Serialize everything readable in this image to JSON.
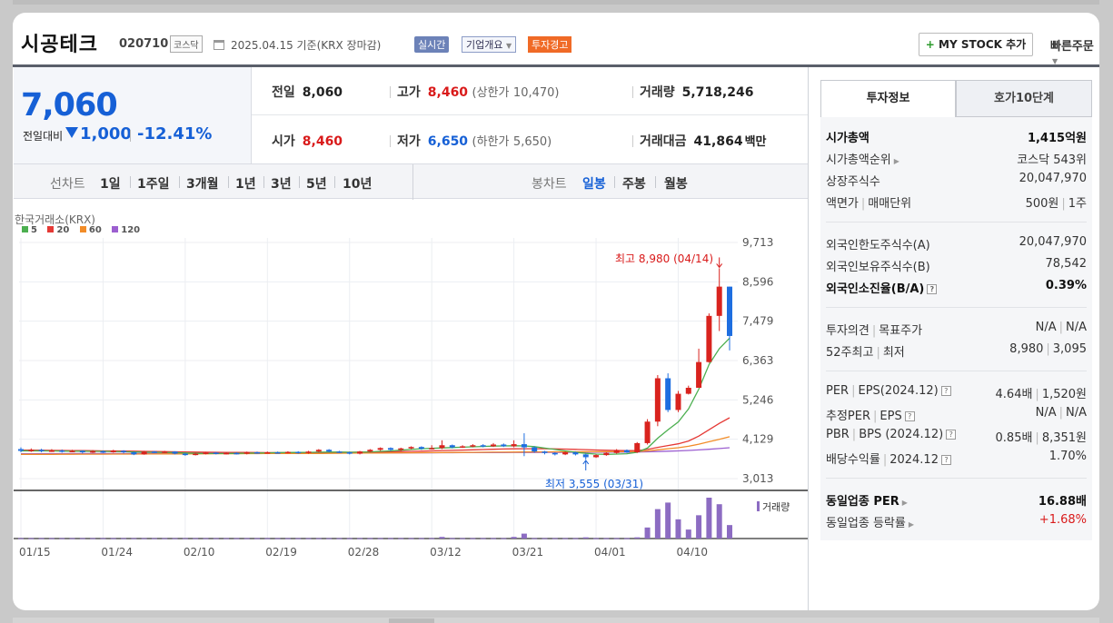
{
  "header": {
    "stock_name": "시공테크",
    "stock_code": "020710",
    "market": "코스닥",
    "date_text": "2025.04.15 기준(KRX 장마감)",
    "realtime_label": "실시간",
    "company_info_label": "기업개요",
    "warning_label": "투자경고",
    "mystock_label": "MY STOCK 추가",
    "quick_order_label": "빠른주문"
  },
  "price": {
    "current": "7,060",
    "change_label": "전일대비",
    "change": "1,000",
    "change_rate": "-12.41%"
  },
  "quote": {
    "prev_close_label": "전일",
    "prev_close": "8,060",
    "high_label": "고가",
    "high": "8,460",
    "upper_limit_label": "(상한가",
    "upper_limit": "10,470",
    "upper_limit_close": ")",
    "volume_label": "거래량",
    "volume": "5,718,246",
    "open_label": "시가",
    "open": "8,460",
    "low_label": "저가",
    "low": "6,650",
    "lower_limit_label": "(하한가",
    "lower_limit": "5,650",
    "lower_limit_close": ")",
    "value_label": "거래대금",
    "value": "41,864",
    "value_unit": "백만"
  },
  "chart_toolbar": {
    "line_label": "선차트",
    "periods": [
      "1일",
      "1주일",
      "3개월",
      "1년",
      "3년",
      "5년",
      "10년"
    ],
    "candle_label": "봉차트",
    "candle_periods": [
      "일봉",
      "주봉",
      "월봉"
    ],
    "active_candle": "일봉"
  },
  "chart_data": {
    "type": "candlestick",
    "title": "한국거래소(KRX)",
    "legend": [
      "5",
      "20",
      "60",
      "120"
    ],
    "legend_colors": [
      "#4caf50",
      "#e53935",
      "#f28c28",
      "#9c5fd0"
    ],
    "y_ticks": [
      "9,713",
      "8,596",
      "7,479",
      "6,363",
      "5,246",
      "4,129",
      "3,013"
    ],
    "ylim": [
      3013,
      9713
    ],
    "x_ticks": [
      "01/15",
      "01/24",
      "02/10",
      "02/19",
      "02/28",
      "03/12",
      "03/21",
      "04/01",
      "04/10"
    ],
    "annotation_high": "최고 8,980 (04/14)",
    "annotation_low": "최저 3,555 (03/31)",
    "volume_label": "거래량",
    "candles": [
      {
        "o": 3850,
        "c": 3800,
        "h": 3900,
        "l": 3760
      },
      {
        "o": 3800,
        "c": 3830,
        "h": 3870,
        "l": 3770
      },
      {
        "o": 3830,
        "c": 3790,
        "h": 3860,
        "l": 3760
      },
      {
        "o": 3790,
        "c": 3810,
        "h": 3850,
        "l": 3770
      },
      {
        "o": 3810,
        "c": 3780,
        "h": 3840,
        "l": 3750
      },
      {
        "o": 3780,
        "c": 3800,
        "h": 3830,
        "l": 3760
      },
      {
        "o": 3800,
        "c": 3760,
        "h": 3820,
        "l": 3730
      },
      {
        "o": 3760,
        "c": 3790,
        "h": 3820,
        "l": 3740
      },
      {
        "o": 3790,
        "c": 3770,
        "h": 3810,
        "l": 3740
      },
      {
        "o": 3770,
        "c": 3800,
        "h": 3830,
        "l": 3750
      },
      {
        "o": 3800,
        "c": 3760,
        "h": 3820,
        "l": 3730
      },
      {
        "o": 3760,
        "c": 3700,
        "h": 3780,
        "l": 3680
      },
      {
        "o": 3700,
        "c": 3780,
        "h": 3800,
        "l": 3690
      },
      {
        "o": 3780,
        "c": 3760,
        "h": 3800,
        "l": 3740
      },
      {
        "o": 3760,
        "c": 3780,
        "h": 3800,
        "l": 3740
      },
      {
        "o": 3780,
        "c": 3720,
        "h": 3790,
        "l": 3700
      },
      {
        "o": 3720,
        "c": 3680,
        "h": 3740,
        "l": 3660
      },
      {
        "o": 3680,
        "c": 3720,
        "h": 3740,
        "l": 3670
      },
      {
        "o": 3720,
        "c": 3750,
        "h": 3770,
        "l": 3700
      },
      {
        "o": 3750,
        "c": 3720,
        "h": 3770,
        "l": 3700
      },
      {
        "o": 3720,
        "c": 3740,
        "h": 3760,
        "l": 3700
      },
      {
        "o": 3740,
        "c": 3720,
        "h": 3760,
        "l": 3700
      },
      {
        "o": 3720,
        "c": 3760,
        "h": 3780,
        "l": 3700
      },
      {
        "o": 3760,
        "c": 3740,
        "h": 3780,
        "l": 3720
      },
      {
        "o": 3740,
        "c": 3760,
        "h": 3780,
        "l": 3720
      },
      {
        "o": 3760,
        "c": 3750,
        "h": 3780,
        "l": 3730
      },
      {
        "o": 3750,
        "c": 3770,
        "h": 3790,
        "l": 3730
      },
      {
        "o": 3770,
        "c": 3740,
        "h": 3790,
        "l": 3720
      },
      {
        "o": 3740,
        "c": 3780,
        "h": 3800,
        "l": 3720
      },
      {
        "o": 3780,
        "c": 3830,
        "h": 3850,
        "l": 3760
      },
      {
        "o": 3830,
        "c": 3780,
        "h": 3850,
        "l": 3760
      },
      {
        "o": 3780,
        "c": 3760,
        "h": 3800,
        "l": 3740
      },
      {
        "o": 3760,
        "c": 3720,
        "h": 3780,
        "l": 3700
      },
      {
        "o": 3720,
        "c": 3780,
        "h": 3800,
        "l": 3700
      },
      {
        "o": 3780,
        "c": 3830,
        "h": 3850,
        "l": 3760
      },
      {
        "o": 3830,
        "c": 3880,
        "h": 3900,
        "l": 3800
      },
      {
        "o": 3880,
        "c": 3830,
        "h": 3900,
        "l": 3800
      },
      {
        "o": 3830,
        "c": 3870,
        "h": 3890,
        "l": 3800
      },
      {
        "o": 3870,
        "c": 3910,
        "h": 3930,
        "l": 3840
      },
      {
        "o": 3910,
        "c": 3860,
        "h": 3930,
        "l": 3830
      },
      {
        "o": 3860,
        "c": 3880,
        "h": 3960,
        "l": 3840
      },
      {
        "o": 3880,
        "c": 3960,
        "h": 4100,
        "l": 3850
      },
      {
        "o": 3960,
        "c": 3900,
        "h": 3980,
        "l": 3870
      },
      {
        "o": 3900,
        "c": 3930,
        "h": 3960,
        "l": 3880
      },
      {
        "o": 3930,
        "c": 3960,
        "h": 3990,
        "l": 3900
      },
      {
        "o": 3960,
        "c": 3930,
        "h": 3990,
        "l": 3900
      },
      {
        "o": 3930,
        "c": 3980,
        "h": 4020,
        "l": 3910
      },
      {
        "o": 3980,
        "c": 3930,
        "h": 4010,
        "l": 3910
      },
      {
        "o": 3930,
        "c": 3990,
        "h": 4100,
        "l": 3900
      },
      {
        "o": 3990,
        "c": 3900,
        "h": 4300,
        "l": 3650
      },
      {
        "o": 3900,
        "c": 3780,
        "h": 3930,
        "l": 3750
      },
      {
        "o": 3780,
        "c": 3740,
        "h": 3800,
        "l": 3700
      },
      {
        "o": 3740,
        "c": 3700,
        "h": 3760,
        "l": 3670
      },
      {
        "o": 3700,
        "c": 3760,
        "h": 3780,
        "l": 3680
      },
      {
        "o": 3760,
        "c": 3700,
        "h": 3780,
        "l": 3670
      },
      {
        "o": 3700,
        "c": 3620,
        "h": 3720,
        "l": 3555
      },
      {
        "o": 3620,
        "c": 3680,
        "h": 3700,
        "l": 3600
      },
      {
        "o": 3680,
        "c": 3740,
        "h": 3760,
        "l": 3660
      },
      {
        "o": 3740,
        "c": 3820,
        "h": 3850,
        "l": 3720
      },
      {
        "o": 3820,
        "c": 3760,
        "h": 3840,
        "l": 3740
      },
      {
        "o": 3760,
        "c": 4020,
        "h": 4050,
        "l": 3740
      },
      {
        "o": 4020,
        "c": 4630,
        "h": 4700,
        "l": 3980
      },
      {
        "o": 4630,
        "c": 5860,
        "h": 5950,
        "l": 4500
      },
      {
        "o": 5860,
        "c": 4960,
        "h": 6000,
        "l": 4900
      },
      {
        "o": 4960,
        "c": 5420,
        "h": 5500,
        "l": 4900
      },
      {
        "o": 5420,
        "c": 5590,
        "h": 5650,
        "l": 5400
      },
      {
        "o": 5590,
        "c": 6320,
        "h": 6700,
        "l": 5600
      },
      {
        "o": 6320,
        "c": 7630,
        "h": 7700,
        "l": 6300
      },
      {
        "o": 7630,
        "c": 8460,
        "h": 8980,
        "l": 7200
      },
      {
        "o": 8460,
        "c": 7060,
        "h": 8460,
        "l": 6650
      }
    ],
    "ma5": [
      3800,
      3805,
      3800,
      3800,
      3795,
      3790,
      3790,
      3785,
      3785,
      3780,
      3775,
      3770,
      3765,
      3760,
      3755,
      3750,
      3740,
      3730,
      3725,
      3725,
      3725,
      3730,
      3735,
      3740,
      3745,
      3750,
      3752,
      3755,
      3758,
      3762,
      3765,
      3765,
      3760,
      3762,
      3770,
      3785,
      3800,
      3820,
      3840,
      3860,
      3870,
      3885,
      3895,
      3905,
      3915,
      3925,
      3935,
      3940,
      3945,
      3940,
      3920,
      3880,
      3840,
      3800,
      3760,
      3730,
      3710,
      3700,
      3710,
      3720,
      3760,
      3880,
      4160,
      4400,
      4620,
      4990,
      5550,
      6250,
      6700,
      7000
    ],
    "ma20": [
      3820,
      3820,
      3818,
      3815,
      3812,
      3810,
      3808,
      3805,
      3800,
      3798,
      3795,
      3790,
      3786,
      3782,
      3778,
      3774,
      3770,
      3766,
      3762,
      3760,
      3758,
      3756,
      3754,
      3752,
      3750,
      3750,
      3750,
      3752,
      3754,
      3756,
      3758,
      3760,
      3760,
      3762,
      3766,
      3770,
      3775,
      3780,
      3786,
      3792,
      3800,
      3808,
      3815,
      3822,
      3830,
      3838,
      3846,
      3852,
      3858,
      3862,
      3862,
      3860,
      3856,
      3850,
      3842,
      3834,
      3826,
      3818,
      3812,
      3806,
      3810,
      3840,
      3900,
      3950,
      4000,
      4080,
      4220,
      4400,
      4580,
      4740
    ],
    "ma60": [
      3700,
      3700,
      3701,
      3702,
      3703,
      3704,
      3705,
      3706,
      3707,
      3708,
      3709,
      3710,
      3711,
      3712,
      3713,
      3714,
      3715,
      3716,
      3717,
      3718,
      3719,
      3720,
      3721,
      3722,
      3723,
      3724,
      3725,
      3726,
      3727,
      3728,
      3730,
      3732,
      3734,
      3736,
      3738,
      3740,
      3742,
      3744,
      3746,
      3748,
      3750,
      3752,
      3754,
      3756,
      3758,
      3760,
      3762,
      3764,
      3766,
      3768,
      3770,
      3771,
      3772,
      3773,
      3774,
      3775,
      3776,
      3777,
      3778,
      3779,
      3782,
      3800,
      3830,
      3860,
      3890,
      3930,
      3990,
      4060,
      4130,
      4200
    ],
    "ma120": [
      3720,
      3720,
      3721,
      3722,
      3722,
      3723,
      3723,
      3724,
      3724,
      3725,
      3725,
      3726,
      3726,
      3727,
      3727,
      3728,
      3728,
      3729,
      3729,
      3730,
      3730,
      3731,
      3731,
      3732,
      3732,
      3733,
      3733,
      3734,
      3734,
      3735,
      3736,
      3737,
      3738,
      3739,
      3740,
      3741,
      3742,
      3743,
      3744,
      3745,
      3746,
      3747,
      3748,
      3749,
      3750,
      3751,
      3752,
      3753,
      3754,
      3755,
      3756,
      3757,
      3758,
      3759,
      3760,
      3761,
      3762,
      3763,
      3764,
      3765,
      3767,
      3772,
      3780,
      3790,
      3800,
      3812,
      3828,
      3846,
      3866,
      3890
    ],
    "volume": [
      0.01,
      0.01,
      0.01,
      0.01,
      0.01,
      0.01,
      0.01,
      0.01,
      0.01,
      0.01,
      0.01,
      0.01,
      0.01,
      0.01,
      0.01,
      0.01,
      0.01,
      0.01,
      0.01,
      0.01,
      0.01,
      0.01,
      0.01,
      0.01,
      0.01,
      0.01,
      0.01,
      0.01,
      0.01,
      0.01,
      0.01,
      0.01,
      0.01,
      0.01,
      0.01,
      0.01,
      0.01,
      0.01,
      0.01,
      0.01,
      0.01,
      0.04,
      0.01,
      0.01,
      0.01,
      0.01,
      0.01,
      0.01,
      0.04,
      0.12,
      0.01,
      0.01,
      0.01,
      0.01,
      0.01,
      0.03,
      0.01,
      0.01,
      0.01,
      0.01,
      0.03,
      0.27,
      0.72,
      0.88,
      0.47,
      0.22,
      0.57,
      1.0,
      0.84,
      0.33
    ]
  },
  "invest_panel": {
    "tab_info": "투자정보",
    "tab_orderbook": "호가10단계",
    "market_cap_label": "시가총액",
    "market_cap": "1,415억원",
    "cap_rank_label": "시가총액순위",
    "cap_rank": "코스닥 543위",
    "shares_label": "상장주식수",
    "shares": "20,047,970",
    "par_label": "액면가",
    "trade_unit_label": "매매단위",
    "par": "500원",
    "trade_unit": "1주",
    "foreign_limit_label": "외국인한도주식수(A)",
    "foreign_limit": "20,047,970",
    "foreign_hold_label": "외국인보유주식수(B)",
    "foreign_hold": "78,542",
    "foreign_ratio_label": "외국인소진율(B/A)",
    "foreign_ratio": "0.39%",
    "opinion_label": "투자의견",
    "target_label": "목표주가",
    "opinion": "N/A",
    "target": "N/A",
    "w52_high_label": "52주최고",
    "w52_low_label": "최저",
    "w52_high": "8,980",
    "w52_low": "3,095",
    "per_label": "PER",
    "eps_label": "EPS(2024.12)",
    "per": "4.64배",
    "eps": "1,520원",
    "est_per_label": "추정PER",
    "est_eps_label": "EPS",
    "est_per": "N/A",
    "est_eps": "N/A",
    "pbr_label": "PBR",
    "bps_label": "BPS (2024.12)",
    "pbr": "0.85배",
    "bps": "8,351원",
    "div_label": "배당수익률",
    "div_date_label": "2024.12",
    "div": "1.70%",
    "sector_per_label": "동일업종 PER",
    "sector_per": "16.88배",
    "sector_change_label": "동일업종 등락률",
    "sector_change": "+1.68%"
  }
}
